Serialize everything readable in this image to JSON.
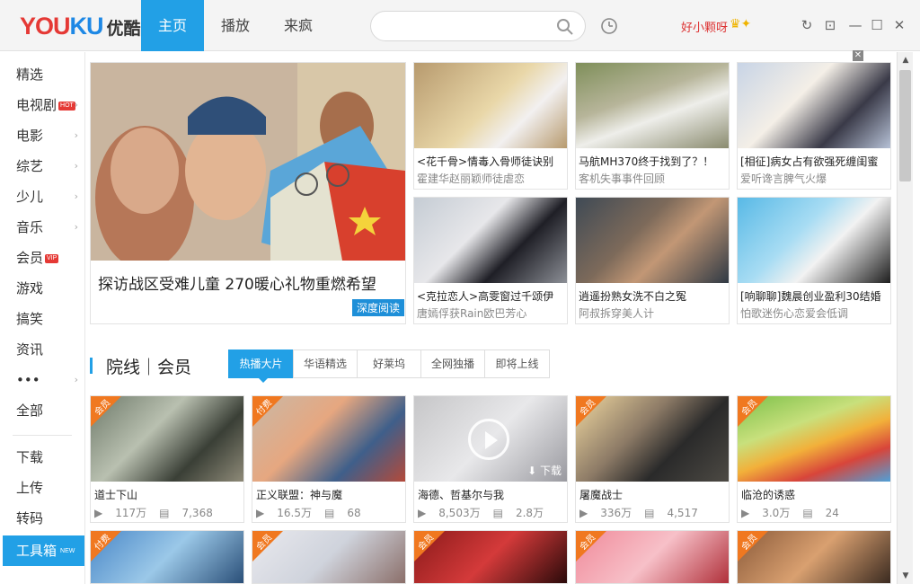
{
  "app": {
    "logo_text": "YOUKU",
    "logo_cn": "优酷",
    "tabs": [
      {
        "label": "主页",
        "active": true
      },
      {
        "label": "播放",
        "active": false
      },
      {
        "label": "来疯",
        "active": false
      }
    ],
    "search": {
      "placeholder": "",
      "value": ""
    },
    "username": "好小颗呀",
    "accent": "#22a0e6"
  },
  "sidebar": {
    "items": [
      {
        "label": "精选",
        "tag": "",
        "arrow": false
      },
      {
        "label": "电视剧",
        "tag": "HOT",
        "arrow": true
      },
      {
        "label": "电影",
        "tag": "",
        "arrow": true
      },
      {
        "label": "综艺",
        "tag": "",
        "arrow": true
      },
      {
        "label": "少儿",
        "tag": "",
        "arrow": true
      },
      {
        "label": "音乐",
        "tag": "",
        "arrow": true
      },
      {
        "label": "会员",
        "tag": "VIP",
        "arrow": false
      },
      {
        "label": "游戏",
        "tag": "",
        "arrow": false
      },
      {
        "label": "搞笑",
        "tag": "",
        "arrow": false
      },
      {
        "label": "资讯",
        "tag": "",
        "arrow": false
      },
      {
        "label": "•••",
        "tag": "",
        "arrow": true
      },
      {
        "label": "全部",
        "tag": "",
        "arrow": false
      }
    ],
    "bottom": [
      {
        "label": "下载",
        "tag": ""
      },
      {
        "label": "上传",
        "tag": ""
      },
      {
        "label": "转码",
        "tag": ""
      },
      {
        "label": "工具箱",
        "tag": "NEW",
        "selected": true
      }
    ]
  },
  "hero": {
    "title": "探访战区受难儿童 270暖心礼物重燃希望",
    "deep_read": "深度阅读"
  },
  "news": [
    {
      "title": "<花千骨>情毒入骨师徒诀别",
      "sub": "霍建华赵丽颖师徒虐恋"
    },
    {
      "title": "马航MH370终于找到了？！",
      "sub": "客机失事事件回顾"
    },
    {
      "title": "[相征]病女占有欲强死缠闺蜜",
      "sub": "爱听谗言脾气火爆"
    },
    {
      "title": "<克拉恋人>高雯窗过千颂伊",
      "sub": "唐嫣俘获Rain欧巴芳心"
    },
    {
      "title": "逍遥扮熟女洗不白之冤",
      "sub": "阿叔拆穿美人计"
    },
    {
      "title": "[响聊聊]魏晨创业盈利30结婚",
      "sub": "怕歌迷伤心恋爱会低调"
    }
  ],
  "section": {
    "title": "院线｜会员",
    "tabs": [
      "热播大片",
      "华语精选",
      "好莱坞",
      "全网独播",
      "即将上线"
    ],
    "active_tab": 0
  },
  "movies": [
    {
      "name": "道士下山",
      "badge": "会员",
      "plays": "117万",
      "comments": "7,368"
    },
    {
      "name": "正义联盟：神与魔",
      "badge": "付费",
      "plays": "16.5万",
      "comments": "68"
    },
    {
      "name": "海德、哲基尔与我",
      "badge": "",
      "plays": "8,503万",
      "comments": "2.8万",
      "download": "下载"
    },
    {
      "name": "屠魔战士",
      "badge": "会员",
      "plays": "336万",
      "comments": "4,517"
    },
    {
      "name": "临沧的诱惑",
      "badge": "会员",
      "plays": "3.0万",
      "comments": "24"
    }
  ],
  "bottom_row": [
    {
      "badge": "付费"
    },
    {
      "badge": "会员"
    },
    {
      "badge": "会员"
    },
    {
      "badge": "会员"
    },
    {
      "badge": "会员"
    }
  ]
}
